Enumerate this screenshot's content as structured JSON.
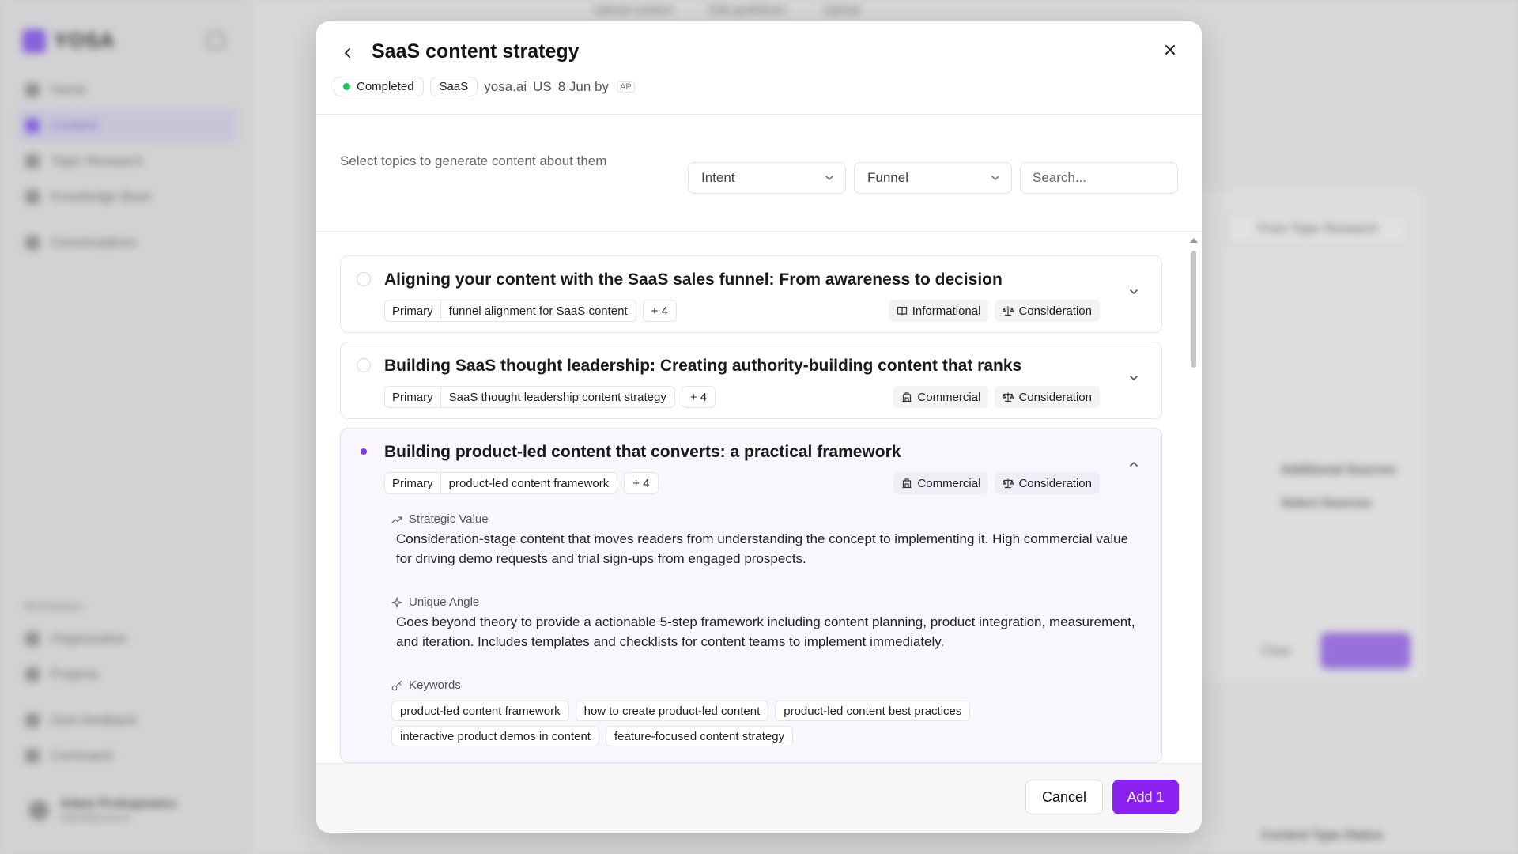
{
  "background": {
    "logo_text": "YOSA",
    "nav": [
      "Home",
      "Content",
      "Topic Research",
      "Knowledge Base",
      "Conversations"
    ],
    "section_label": "Workspace",
    "nav2": [
      "Organization",
      "Projects",
      "Give feedback",
      "Command"
    ],
    "user_name": "Adam Prokopowicz",
    "user_email": "adam@yosa.ai",
    "tabs": [
      "Upload content",
      "Edit guidelines",
      "Upload"
    ],
    "right_button": "From Topic Research",
    "right_labels": [
      "Additional Sources",
      "Select Sources"
    ],
    "clear_label": "Clear",
    "footer_hint": "Content Type  Status"
  },
  "modal": {
    "title": "SaaS content strategy",
    "status": "Completed",
    "category": "SaaS",
    "domain": "yosa.ai",
    "country": "US",
    "date": "8 Jun by",
    "author_initials": "AP",
    "instruction": "Select topics to generate content about them",
    "filters": {
      "intent": "Intent",
      "funnel": "Funnel",
      "search_placeholder": "Search..."
    },
    "cards": [
      {
        "title": "Aligning your content with the SaaS sales funnel: From awareness to decision",
        "primary_label": "Primary",
        "primary_keyword": "funnel alignment for SaaS content",
        "more": "+ 4",
        "intent": "Informational",
        "stage": "Consideration"
      },
      {
        "title": "Building SaaS thought leadership: Creating authority-building content that ranks",
        "primary_label": "Primary",
        "primary_keyword": "SaaS thought leadership content strategy",
        "more": "+ 4",
        "intent": "Commercial",
        "stage": "Consideration"
      },
      {
        "title": "Building product-led content that converts: a practical framework",
        "primary_label": "Primary",
        "primary_keyword": "product-led content framework",
        "more": "+ 4",
        "intent": "Commercial",
        "stage": "Consideration",
        "strategic_value_label": "Strategic Value",
        "strategic_value": "Consideration-stage content that moves readers from understanding the concept to implementing it. High commercial value for driving demo requests and trial sign-ups from engaged prospects.",
        "unique_angle_label": "Unique Angle",
        "unique_angle": "Goes beyond theory to provide a actionable 5-step framework including content planning, product integration, measurement, and iteration. Includes templates and checklists for content teams to implement immediately.",
        "keywords_label": "Keywords",
        "keywords": [
          "product-led content framework",
          "how to create product-led content",
          "product-led content best practices",
          "interactive product demos in content",
          "feature-focused content strategy"
        ]
      }
    ],
    "cancel": "Cancel",
    "add": "Add 1"
  }
}
